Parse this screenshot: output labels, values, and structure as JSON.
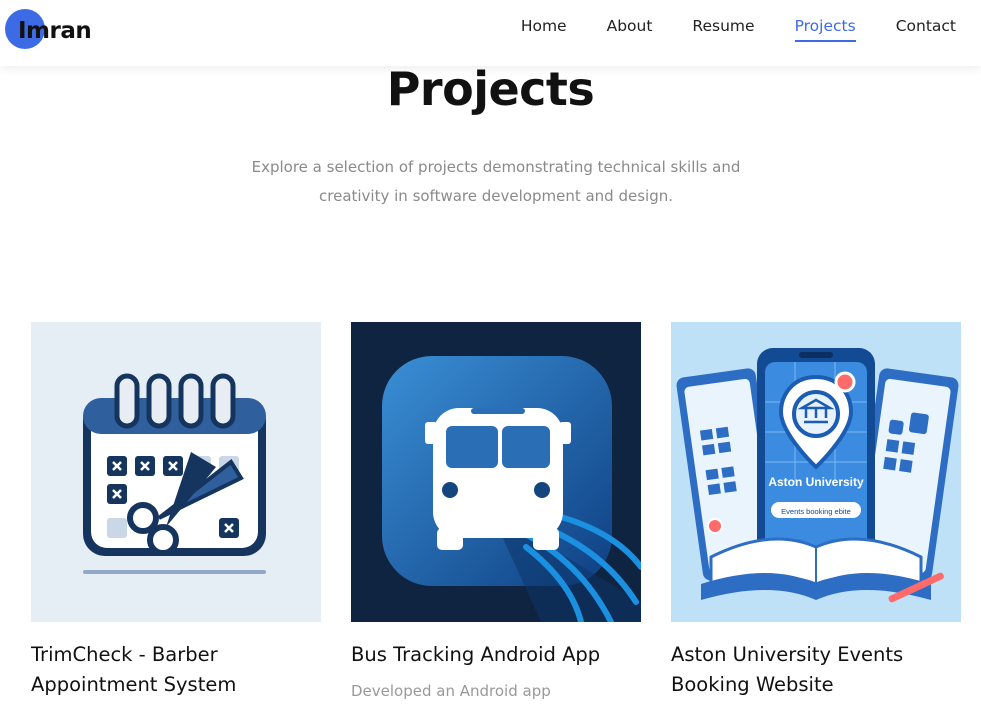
{
  "header": {
    "logo_text": "Imran",
    "nav": [
      {
        "label": "Home",
        "active": false
      },
      {
        "label": "About",
        "active": false
      },
      {
        "label": "Resume",
        "active": false
      },
      {
        "label": "Projects",
        "active": true
      },
      {
        "label": "Contact",
        "active": false
      }
    ]
  },
  "section": {
    "title": "Projects",
    "subtitle": "Explore a selection of projects demonstrating technical skills and creativity in software development and design."
  },
  "projects": [
    {
      "title": "TrimCheck - Barber Appointment System",
      "description": "",
      "image_icon": "calendar-scissors-icon"
    },
    {
      "title": "Bus Tracking Android App",
      "description": "Developed an Android app",
      "image_icon": "bus-icon"
    },
    {
      "title": "Aston University Events Booking Website",
      "description": "",
      "image_icon": "phone-map-pin-icon",
      "image_text": {
        "brand": "Aston University",
        "banner": "Events booking ebite"
      }
    }
  ],
  "colors": {
    "accent": "#3d6be6",
    "text": "#111111",
    "muted": "#8a8a8a"
  }
}
